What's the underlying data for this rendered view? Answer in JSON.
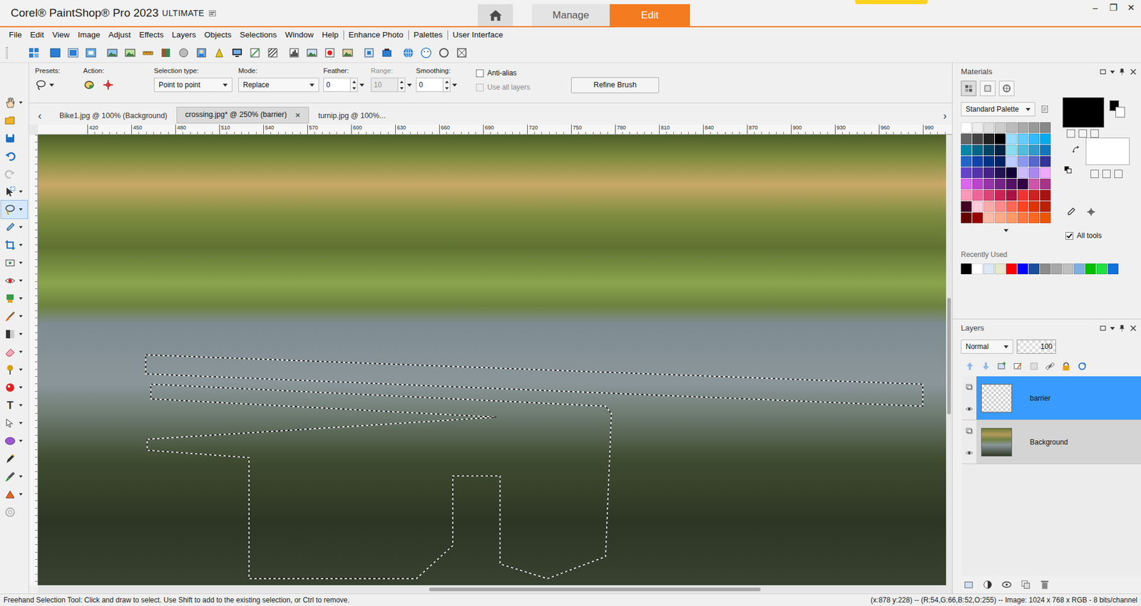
{
  "window": {
    "title": "Corel® PaintShop® Pro 2023",
    "edition": "ULTIMATE",
    "controls": [
      "–",
      "❐",
      "✕"
    ]
  },
  "workspaces": [
    {
      "label": "Manage",
      "selected": false
    },
    {
      "label": "Edit",
      "selected": true
    }
  ],
  "menu": {
    "main": [
      "File",
      "Edit",
      "View",
      "Image",
      "Adjust",
      "Effects",
      "Layers",
      "Objects",
      "Selections",
      "Window",
      "Help"
    ],
    "extra": [
      "Enhance Photo",
      "Palettes",
      "User Interface"
    ]
  },
  "tools": [
    {
      "selected": false,
      "disabled": false
    },
    {
      "selected": false,
      "disabled": false
    },
    {
      "selected": false,
      "disabled": false
    },
    {
      "selected": false,
      "disabled": false
    },
    {
      "selected": false,
      "disabled": true
    },
    {
      "selected": false,
      "disabled": false
    },
    {
      "selected": true,
      "disabled": false
    },
    {
      "selected": false,
      "disabled": false
    },
    {
      "selected": false,
      "disabled": false
    },
    {
      "selected": false,
      "disabled": false
    },
    {
      "selected": false,
      "disabled": false
    },
    {
      "selected": false,
      "disabled": false
    },
    {
      "selected": false,
      "disabled": false
    },
    {
      "selected": false,
      "disabled": false
    },
    {
      "selected": false,
      "disabled": false
    },
    {
      "selected": false,
      "disabled": false
    },
    {
      "selected": false,
      "disabled": false
    },
    {
      "selected": false,
      "disabled": false,
      "glyph": "T"
    },
    {
      "selected": false,
      "disabled": false
    },
    {
      "selected": false,
      "disabled": false
    },
    {
      "selected": false,
      "disabled": false
    },
    {
      "selected": false,
      "disabled": false
    },
    {
      "selected": false,
      "disabled": false
    },
    {
      "selected": false,
      "disabled": false
    }
  ],
  "tool_options": {
    "presets": {
      "label": "Presets:"
    },
    "action": {
      "label": "Action:"
    },
    "selection_type": {
      "label": "Selection type:",
      "value": "Point to point"
    },
    "mode": {
      "label": "Mode:",
      "value": "Replace"
    },
    "feather": {
      "label": "Feather:",
      "value": "0",
      "disabled": false
    },
    "range": {
      "label": "Range:",
      "value": "10",
      "disabled": true
    },
    "smoothing": {
      "label": "Smoothing:",
      "value": "0",
      "disabled": false
    },
    "anti_alias": {
      "label": "Anti-alias",
      "checked": false,
      "disabled": false
    },
    "use_all_layers": {
      "label": "Use all layers",
      "checked": false,
      "disabled": true
    },
    "refine": "Refine Brush"
  },
  "documents": {
    "prev": "‹",
    "next": "›",
    "close": "×",
    "tabs": [
      {
        "label": "Bike1.jpg @ 100% (Background)",
        "selected": false
      },
      {
        "label": "crossing.jpg* @ 250% (barrier)",
        "selected": true
      },
      {
        "label": "turnip.jpg @ 100%...",
        "selected": false
      }
    ]
  },
  "ruler": {
    "ticks": [
      "420",
      "450",
      "480",
      "510",
      "540",
      "570",
      "600",
      "630",
      "660",
      "690",
      "720",
      "750",
      "780",
      "810",
      "840",
      "870",
      "900",
      "930",
      "960",
      "990"
    ]
  },
  "materials": {
    "title": "Materials",
    "palette": "Standard Palette",
    "swatches": [
      {
        "color": "#ffffff"
      },
      {
        "color": "#eeeeee"
      },
      {
        "color": "#dddddd"
      },
      {
        "color": "#cccccc"
      },
      {
        "color": "#bbbbbb"
      },
      {
        "color": "#aaaaaa"
      },
      {
        "color": "#999999"
      },
      {
        "color": "#888888"
      },
      {
        "color": "#666666"
      },
      {
        "color": "#444444"
      },
      {
        "color": "#222222"
      },
      {
        "color": "#000000"
      },
      {
        "color": "#99ddff"
      },
      {
        "color": "#66ccff"
      },
      {
        "color": "#33bbff"
      },
      {
        "color": "#00aaee"
      },
      {
        "color": "#0088aa"
      },
      {
        "color": "#006688"
      },
      {
        "color": "#004466"
      },
      {
        "color": "#002244"
      },
      {
        "color": "#88ddee"
      },
      {
        "color": "#55bbdd"
      },
      {
        "color": "#3399cc"
      },
      {
        "color": "#1177bb"
      },
      {
        "color": "#2266cc"
      },
      {
        "color": "#1144aa"
      },
      {
        "color": "#003388"
      },
      {
        "color": "#002266"
      },
      {
        "color": "#bbccff"
      },
      {
        "color": "#8899ee"
      },
      {
        "color": "#5566cc"
      },
      {
        "color": "#333399"
      },
      {
        "color": "#6644cc"
      },
      {
        "color": "#5533aa"
      },
      {
        "color": "#442288"
      },
      {
        "color": "#221155"
      },
      {
        "color": "#110033"
      },
      {
        "color": "#ccbbff"
      },
      {
        "color": "#aa88ee"
      },
      {
        "color": "#eeaaff"
      },
      {
        "color": "#dd66ee"
      },
      {
        "color": "#bb44cc"
      },
      {
        "color": "#9933aa"
      },
      {
        "color": "#772288"
      },
      {
        "color": "#551166"
      },
      {
        "color": "#330044"
      },
      {
        "color": "#cc55aa"
      },
      {
        "color": "#aa3388"
      },
      {
        "color": "#ff99bb"
      },
      {
        "color": "#ee6699"
      },
      {
        "color": "#dd4477"
      },
      {
        "color": "#cc2255"
      },
      {
        "color": "#aa1144"
      },
      {
        "color": "#ee3333"
      },
      {
        "color": "#cc2222"
      },
      {
        "color": "#aa1111"
      },
      {
        "color": "#440022"
      },
      {
        "color": "#ffccdd"
      },
      {
        "color": "#ffaaaa"
      },
      {
        "color": "#ff8888"
      },
      {
        "color": "#ff6655"
      },
      {
        "color": "#ff4422"
      },
      {
        "color": "#dd3300"
      },
      {
        "color": "#bb2200"
      },
      {
        "color": "#660000"
      },
      {
        "color": "#990000"
      },
      {
        "color": "#ffbbaa"
      },
      {
        "color": "#ffaa88"
      },
      {
        "color": "#ff9966"
      },
      {
        "color": "#ff7744"
      },
      {
        "color": "#ff6622"
      },
      {
        "color": "#ee5500"
      }
    ],
    "recent_label": "Recently Used",
    "recent": [
      {
        "color": "#000000"
      },
      {
        "color": "#ffffff"
      },
      {
        "color": "#dde8f5"
      },
      {
        "color": "#e8e8cc"
      },
      {
        "color": "#ff0000"
      },
      {
        "color": "#0000ff"
      },
      {
        "color": "#1a4f9c"
      },
      {
        "color": "#8c8c8c"
      },
      {
        "color": "#a8a8a8"
      },
      {
        "color": "#c0c0c0"
      },
      {
        "color": "#80b0e0"
      },
      {
        "color": "#00c000"
      },
      {
        "color": "#20e040"
      },
      {
        "color": "#1070e0"
      }
    ],
    "foreground": {
      "color": "#000000"
    },
    "background": {
      "color": "#ffffff"
    },
    "all_tools": {
      "label": "All tools",
      "checked": true
    }
  },
  "layers": {
    "title": "Layers",
    "blend_mode": "Normal",
    "opacity": "100",
    "items": [
      {
        "name": "barrier",
        "selected": true,
        "visible": true,
        "kind": "empty"
      },
      {
        "name": "Background",
        "selected": false,
        "visible": true,
        "kind": "photo"
      }
    ]
  },
  "status_bar": {
    "hint": "Freehand Selection Tool: Click and draw to select. Use Shift to add to the existing selection, or Ctrl to remove.",
    "info": "(x:878 y:228) -- (R:54,G:66,B:52,O:255) -- Image: 1024 x 768 x RGB - 8 bits/channel"
  }
}
